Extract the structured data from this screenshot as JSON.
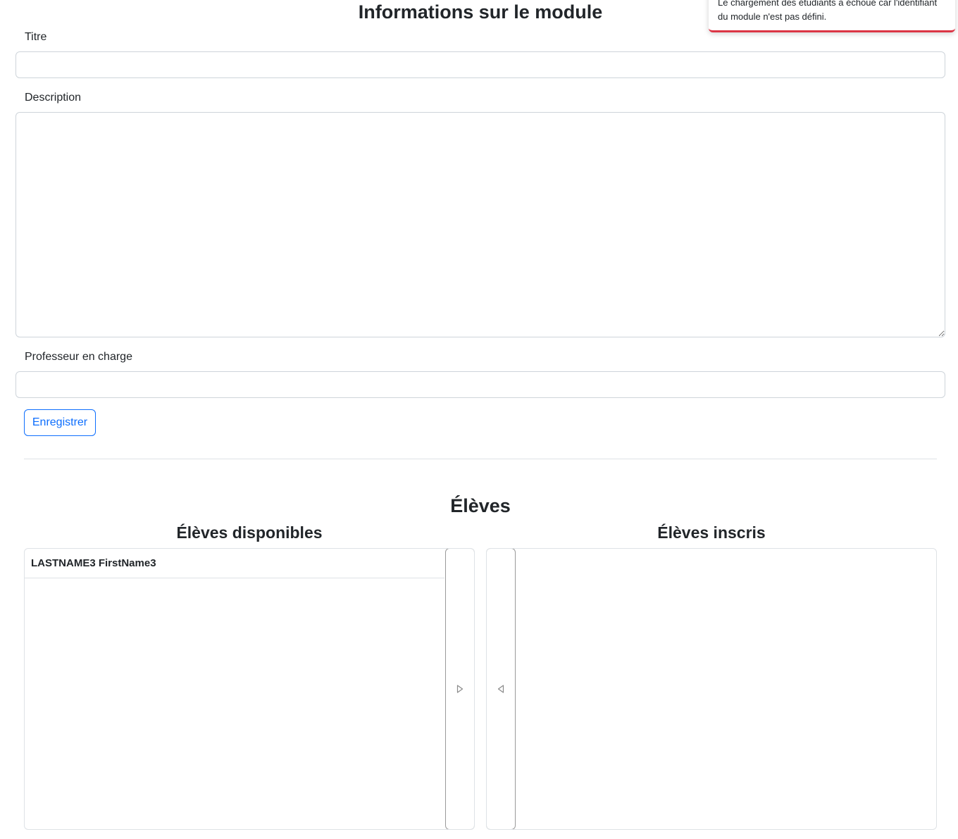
{
  "page": {
    "title": "Informations sur le module"
  },
  "form": {
    "title_label": "Titre",
    "title_value": "",
    "description_label": "Description",
    "description_value": "",
    "teacher_label": "Professeur en charge",
    "teacher_value": "",
    "save_label": "Enregistrer"
  },
  "students": {
    "section_title": "Élèves",
    "available_title": "Élèves disponibles",
    "enrolled_title": "Élèves inscris",
    "available": [
      {
        "name": "LASTNAME3 FirstName3"
      }
    ],
    "enrolled": [],
    "move_right_icon": "triangle-right-icon",
    "move_left_icon": "triangle-left-icon"
  },
  "toast": {
    "message": "Le chargement des étudiants a échoué car l'identifiant du module n'est pas défini.",
    "accent_color": "#dc3545"
  }
}
